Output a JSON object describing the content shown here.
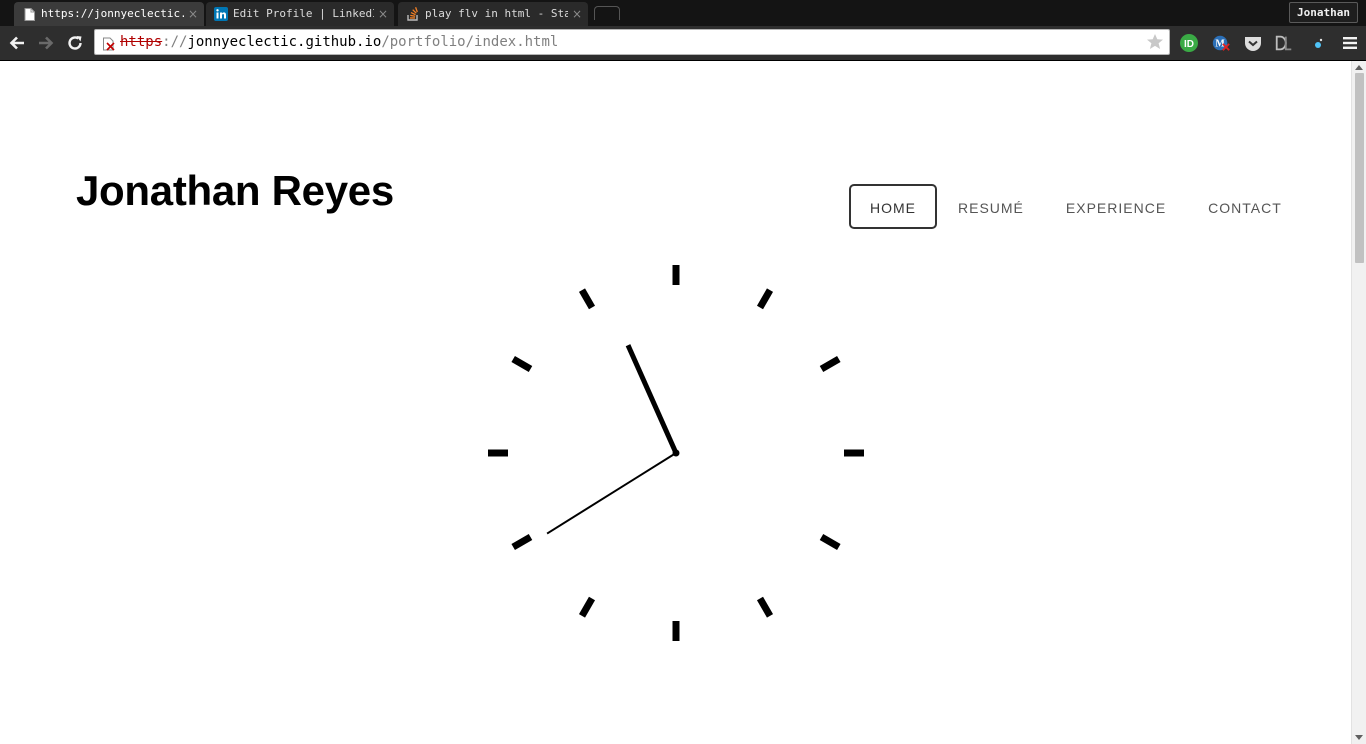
{
  "browser": {
    "tabs": [
      {
        "title": "https://jonnyeclectic.g",
        "favicon": "page-icon",
        "active": true
      },
      {
        "title": "Edit Profile | LinkedIn",
        "favicon": "linkedin-icon",
        "active": false
      },
      {
        "title": "play flv in html - Stac",
        "favicon": "stackoverflow-icon",
        "active": false
      }
    ],
    "tab_close": "×",
    "profile_name": "Jonathan",
    "url": {
      "scheme": "https",
      "separator": "://",
      "host": "jonnyeclectic.github.io",
      "path": "/portfolio/index.html"
    },
    "extensions": [
      "id-extension-icon",
      "m-extension-icon",
      "pocket-icon",
      "dl-extension-icon",
      "cursor-extension-icon"
    ],
    "colors": {
      "scheme_error": "#b00000",
      "tabstrip": "#141414",
      "toolbar": "#2e2e2e"
    }
  },
  "site": {
    "title": "Jonathan Reyes",
    "nav": [
      {
        "label": "HOME",
        "active": true
      },
      {
        "label": "RESUMÉ",
        "active": false
      },
      {
        "label": "EXPERIENCE",
        "active": false
      },
      {
        "label": "CONTACT",
        "active": false
      }
    ]
  },
  "clock": {
    "hour": 7,
    "minute": 56,
    "hand_color": "#000000"
  }
}
